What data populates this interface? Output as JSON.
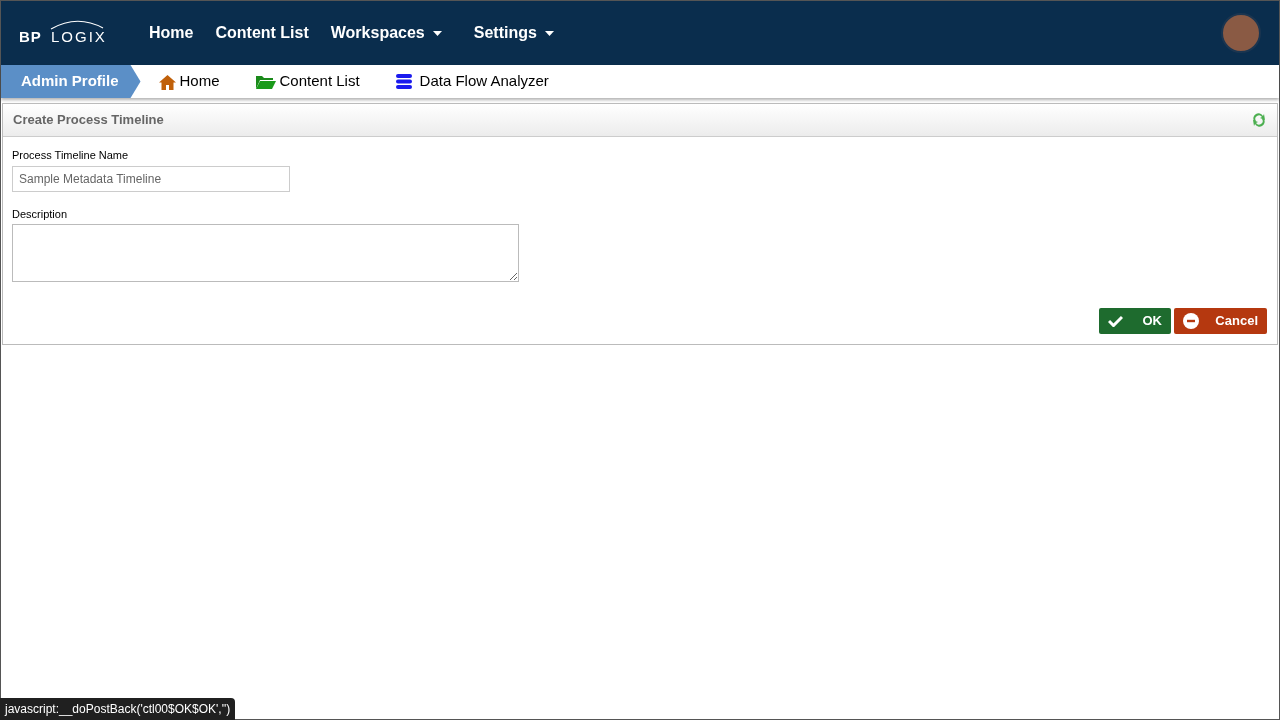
{
  "logo": {
    "text_1": "BP",
    "text_2": "LOGIX"
  },
  "nav": [
    {
      "label": "Home",
      "dropdown": false
    },
    {
      "label": "Content List",
      "dropdown": false
    },
    {
      "label": "Workspaces",
      "dropdown": true
    },
    {
      "label": "Settings",
      "dropdown": true
    }
  ],
  "breadcrumb": {
    "current": "Admin Profile",
    "links": [
      {
        "label": "Home",
        "kind": "home"
      },
      {
        "label": "Content List",
        "kind": "folder"
      },
      {
        "label": "Data Flow Analyzer",
        "kind": "database"
      }
    ]
  },
  "panel": {
    "title": "Create Process Timeline",
    "fields": [
      {
        "label": "Process Timeline Name",
        "kind": "text",
        "placeholder": "Sample Metadata Timeline"
      },
      {
        "label": "Description",
        "kind": "textarea"
      }
    ],
    "buttons": [
      {
        "label": "OK",
        "kind": "ok"
      },
      {
        "label": "Cancel",
        "kind": "cancel"
      }
    ]
  },
  "status_bar": "javascript:__doPostBack('ctl00$OK$OK','')"
}
